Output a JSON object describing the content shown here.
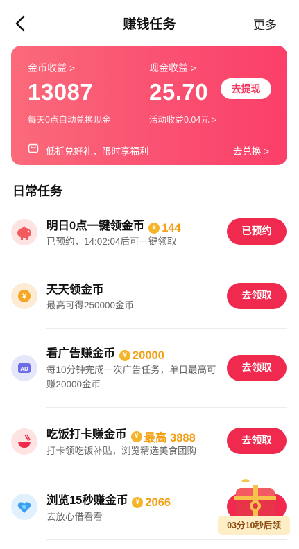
{
  "nav": {
    "title": "赚钱任务",
    "more": "更多"
  },
  "earnings": {
    "coin_label": "金币收益 >",
    "coin_value": "13087",
    "coin_sub": "每天0点自动兑换现金",
    "cash_label": "现金收益 >",
    "cash_value": "25.70",
    "cash_sub": "活动收益0.04元 >",
    "withdraw": "去提现",
    "promo": "低折兑好礼，限时享福利",
    "redeem": "去兑换 >"
  },
  "section_title": "日常任务",
  "tasks": [
    {
      "title": "明日0点一键领金币",
      "reward": "144",
      "desc": "已预约，14:02:04后可一键领取",
      "button": "已预约",
      "icon": "piggy-bank-icon",
      "icon_bg": "#fde3e1"
    },
    {
      "title": "天天领金币",
      "reward": "",
      "desc": "最高可得250000金币",
      "button": "去领取",
      "icon": "coin-icon",
      "icon_bg": "#fdebd3"
    },
    {
      "title": "看广告赚金币",
      "reward": "20000",
      "desc": "每10分钟完成一次广告任务，单日最高可赚20000金币",
      "button": "去领取",
      "icon": "ad-icon",
      "icon_bg": "#e6e6fb"
    },
    {
      "title": "吃饭打卡赚金币",
      "reward": "最高 3888",
      "desc": "打卡领吃饭补贴，浏览精选美食团购",
      "button": "去领取",
      "icon": "food-bowl-icon",
      "icon_bg": "#fde3e1"
    },
    {
      "title": "浏览15秒赚金币",
      "reward": "2066",
      "desc": "去放心借看看",
      "button": "去领取",
      "icon": "heart-shield-icon",
      "icon_bg": "#e0f0fd"
    }
  ],
  "countdown": "03分10秒后领",
  "colors": {
    "accent": "#f0294e",
    "reward": "#f29f14"
  }
}
